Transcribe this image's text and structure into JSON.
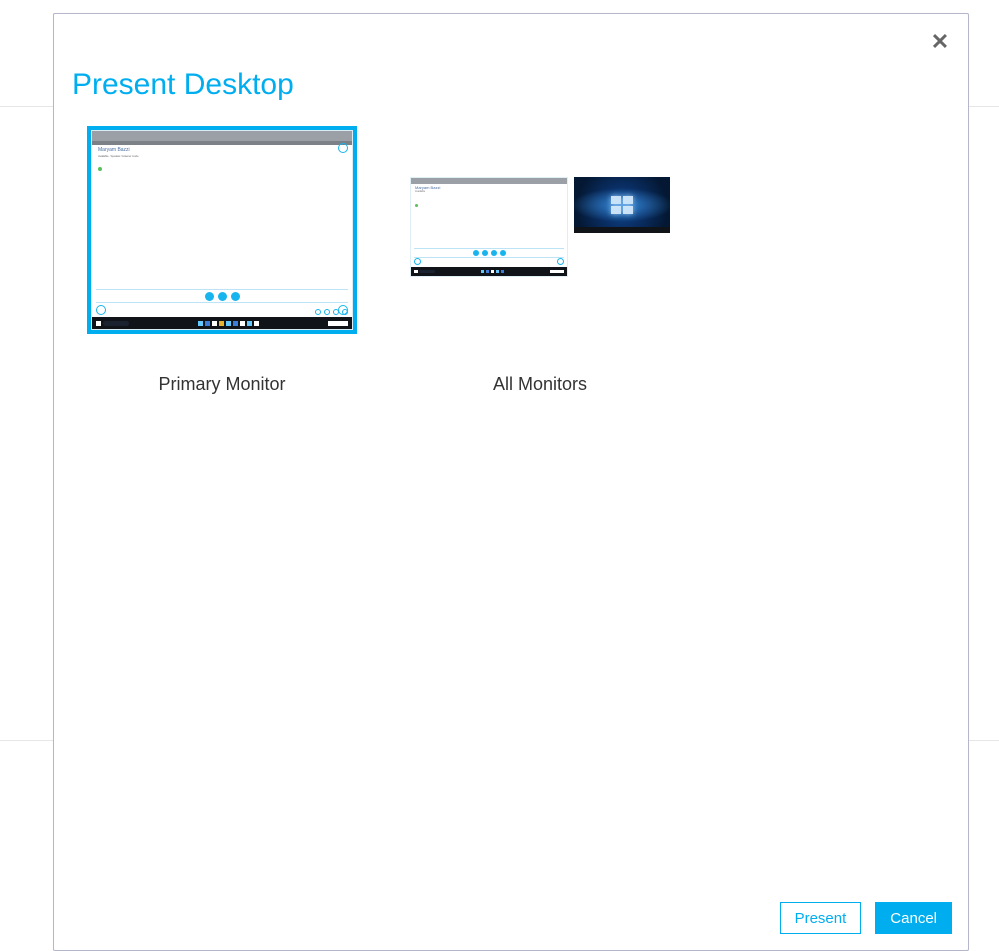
{
  "dialog": {
    "title": "Present Desktop",
    "options": [
      {
        "label": "Primary Monitor",
        "selected": true
      },
      {
        "label": "All Monitors",
        "selected": false
      }
    ],
    "buttons": {
      "present": "Present",
      "cancel": "Cancel"
    }
  },
  "colors": {
    "accent": "#00aef0"
  }
}
